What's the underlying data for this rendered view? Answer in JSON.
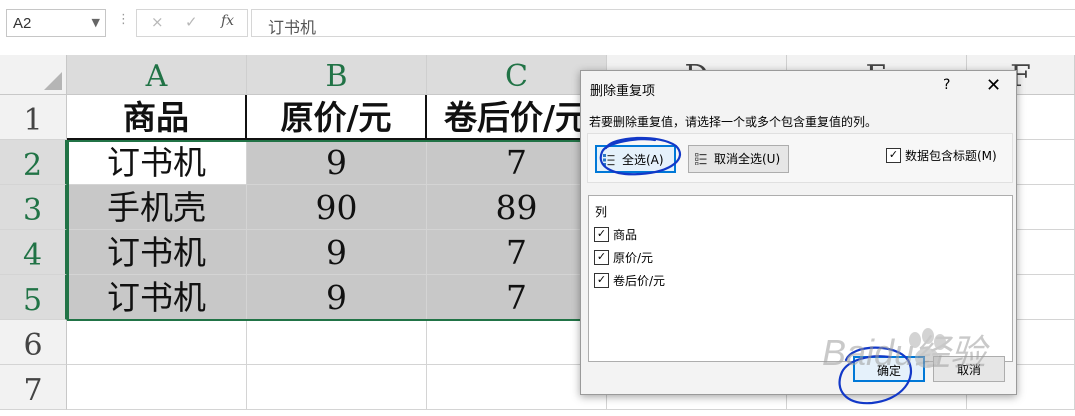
{
  "formula_bar": {
    "name_box": "A2",
    "cancel_icon": "×",
    "enter_icon": "✓",
    "fx_icon": "fx",
    "content": "订书机"
  },
  "sheet": {
    "columns": [
      "A",
      "B",
      "C",
      "D",
      "E",
      "F"
    ],
    "rows": [
      "1",
      "2",
      "3",
      "4",
      "5",
      "6",
      "7"
    ],
    "header_row": [
      "商品",
      "原价/元",
      "卷后价/元"
    ],
    "data_rows": [
      [
        "订书机",
        "9",
        "7"
      ],
      [
        "手机壳",
        "90",
        "89"
      ],
      [
        "订书机",
        "9",
        "7"
      ],
      [
        "订书机",
        "9",
        "7"
      ]
    ],
    "selection_color": "#217346"
  },
  "dialog": {
    "title": "删除重复项",
    "help": "?",
    "close": "✕",
    "message": "若要删除重复值，请选择一个或多个包含重复值的列。",
    "select_all": "全选(A)",
    "unselect_all": "取消全选(U)",
    "has_headers_label": "数据包含标题(M)",
    "has_headers_checked": true,
    "list_title": "列",
    "columns": [
      {
        "label": "商品",
        "checked": true
      },
      {
        "label": "原价/元",
        "checked": true
      },
      {
        "label": "卷后价/元",
        "checked": true
      }
    ],
    "ok": "确定",
    "cancel": "取消",
    "accent_color": "#0078d7"
  },
  "watermark": {
    "text": "Baidu经验"
  }
}
